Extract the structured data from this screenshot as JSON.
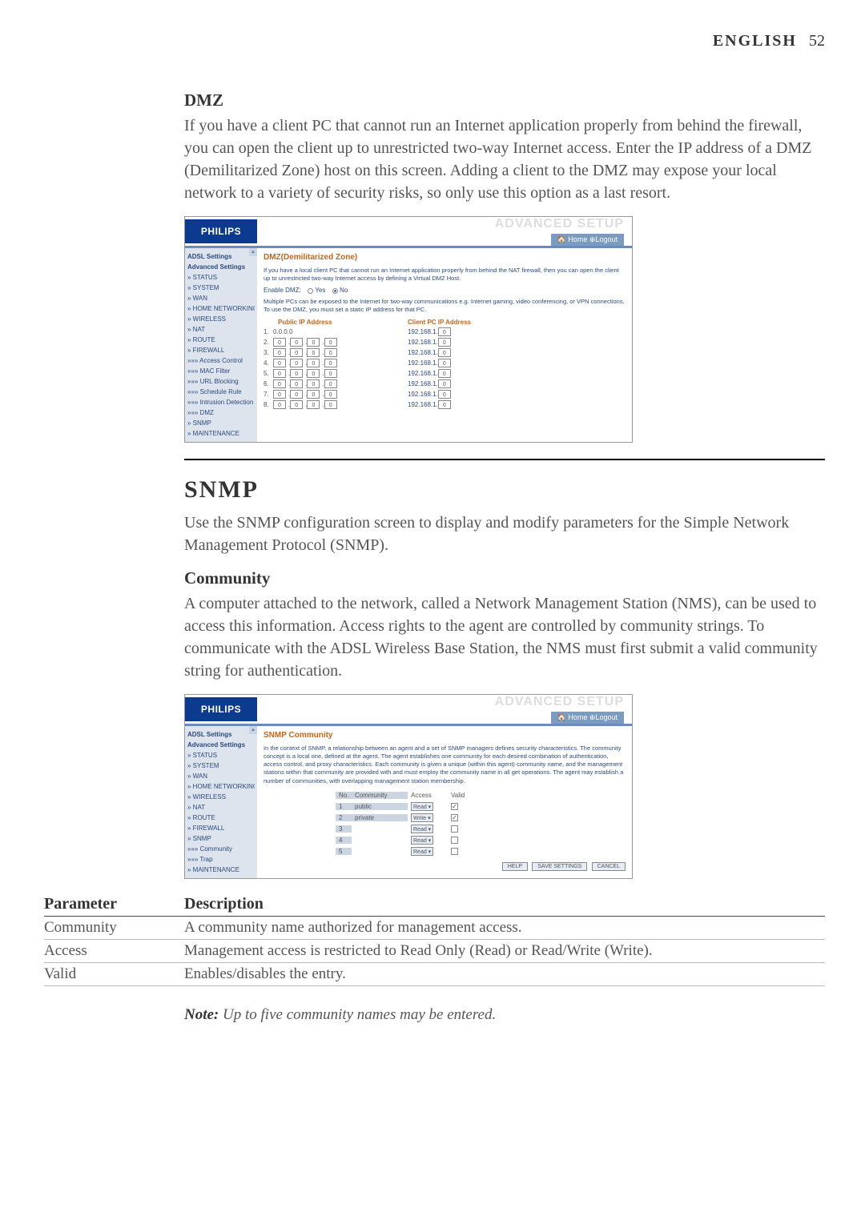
{
  "header": {
    "language": "ENGLISH",
    "page_number": "52"
  },
  "dmz": {
    "title": "DMZ",
    "body": "If you have a client PC that cannot run an Internet application properly from behind the firewall, you can open the client up to unrestricted two-way Internet access. Enter the IP address of a DMZ (Demilitarized Zone) host on this screen. Adding a client to the DMZ may expose your local network to a variety of security risks, so only use this option as a last resort."
  },
  "dmz_screenshot": {
    "logo": "PHILIPS",
    "banner": "ADVANCED SETUP",
    "links": "🏠 Home  ⊕Logout",
    "sidebar_items": [
      {
        "label": "ADSL Settings",
        "bold": true
      },
      {
        "label": "Advanced Settings",
        "bold": true
      },
      {
        "label": "» STATUS"
      },
      {
        "label": "» SYSTEM"
      },
      {
        "label": "» WAN"
      },
      {
        "label": "» HOME NETWORKING"
      },
      {
        "label": "» WIRELESS"
      },
      {
        "label": "» NAT"
      },
      {
        "label": "» ROUTE"
      },
      {
        "label": "» FIREWALL"
      },
      {
        "label": "»»» Access Control"
      },
      {
        "label": "»»» MAC Filter"
      },
      {
        "label": "»»» URL Blocking"
      },
      {
        "label": "»»» Schedule Rule"
      },
      {
        "label": "»»» Intrusion Detection"
      },
      {
        "label": "»»» DMZ"
      },
      {
        "label": "» SNMP"
      },
      {
        "label": "» MAINTENANCE"
      }
    ],
    "content_title": "DMZ(Demilitarized Zone)",
    "desc1": "If you have a local client PC that cannot run an Internet application properly from behind the NAT firewall, then you can open the client up to unrestricted two-way Internet access by defining a Virtual DMZ Host.",
    "enable_label": "Enable DMZ:",
    "yes": "Yes",
    "no": "No",
    "desc2": "Multiple PCs can be exposed to the Internet for two-way communications e.g. Internet gaming, video conferencing, or VPN connections.  To use the DMZ, you must set a static IP address for that PC.",
    "col_public": "Public IP Address",
    "col_client": "Client PC IP Address",
    "row1_public": "0.0.0.0",
    "client_prefix": "192.168.1.",
    "rows": [
      1,
      2,
      3,
      4,
      5,
      6,
      7,
      8
    ]
  },
  "snmp": {
    "title": "SNMP",
    "body": "Use the SNMP configuration screen to display and modify parameters for the Simple Network Management Protocol (SNMP)."
  },
  "community": {
    "title": "Community",
    "body": "A computer attached to the network, called a Network Management Station (NMS), can be used to access this information. Access rights to the agent are controlled by community strings. To communicate with the ADSL Wireless Base Station, the NMS must first submit a valid community string for authentication."
  },
  "snmp_screenshot": {
    "logo": "PHILIPS",
    "banner": "ADVANCED SETUP",
    "links": "🏠 Home  ⊕Logout",
    "sidebar_items": [
      {
        "label": "ADSL Settings",
        "bold": true
      },
      {
        "label": "Advanced Settings",
        "bold": true
      },
      {
        "label": "» STATUS"
      },
      {
        "label": "» SYSTEM"
      },
      {
        "label": "» WAN"
      },
      {
        "label": "» HOME NETWORKING"
      },
      {
        "label": "» WIRELESS"
      },
      {
        "label": "» NAT"
      },
      {
        "label": "» ROUTE"
      },
      {
        "label": "» FIREWALL"
      },
      {
        "label": "» SNMP"
      },
      {
        "label": "»»» Community"
      },
      {
        "label": "»»» Trap"
      },
      {
        "label": "» MAINTENANCE"
      }
    ],
    "content_title": "SNMP Community",
    "desc": "In the context of SNMP, a relationship between an agent and a set of SNMP managers defines security characteristics. The community concept is a local one, defined at the agent. The agent establishes one community for each desired combination of authentication, access control, and proxy characteristics. Each community is given a unique (within this agent) community name, and the management stations within that community are provided with and must employ the community name in all get operations. The agent may establish a number of communities, with overlapping management station membership.",
    "headers": {
      "no": "No.",
      "community": "Community",
      "access": "Access",
      "valid": "Valid"
    },
    "rows": [
      {
        "no": "1",
        "community": "public",
        "access": "Read",
        "checked": true
      },
      {
        "no": "2",
        "community": "private",
        "access": "Write",
        "checked": true
      },
      {
        "no": "3",
        "community": "",
        "access": "Read",
        "checked": false
      },
      {
        "no": "4",
        "community": "",
        "access": "Read",
        "checked": false
      },
      {
        "no": "5",
        "community": "",
        "access": "Read",
        "checked": false
      }
    ],
    "buttons": {
      "help": "HELP",
      "save": "SAVE SETTINGS",
      "cancel": "CANCEL"
    }
  },
  "param_table": {
    "header_param": "Parameter",
    "header_desc": "Description",
    "rows": [
      {
        "param": "Community",
        "desc": "A community name authorized for management access."
      },
      {
        "param": "Access",
        "desc": "Management access is restricted to Read Only (Read) or Read/Write (Write)."
      },
      {
        "param": "Valid",
        "desc": "Enables/disables the entry."
      }
    ]
  },
  "note": {
    "label": "Note:",
    "body": "Up to five community names may be entered."
  }
}
